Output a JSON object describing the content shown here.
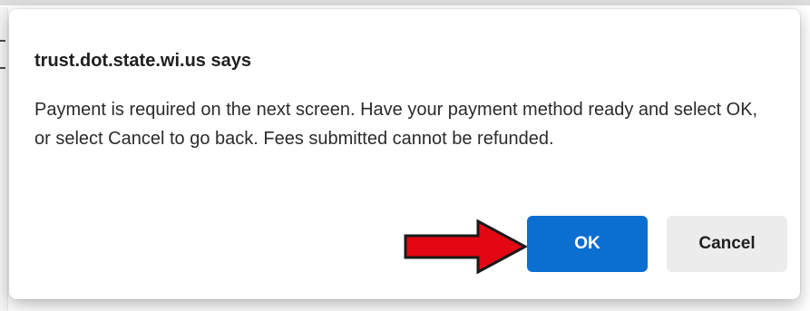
{
  "dialog": {
    "title": "trust.dot.state.wi.us says",
    "message": "Payment is required on the next screen. Have your payment method ready and select OK, or select Cancel to go back. Fees submitted cannot be refunded.",
    "ok_label": "OK",
    "cancel_label": "Cancel"
  },
  "annotation": {
    "arrow_color": "#e30613",
    "arrow_outline": "#1a1a1a"
  },
  "colors": {
    "ok_background": "#0b6fd1",
    "cancel_background": "#ececec"
  }
}
